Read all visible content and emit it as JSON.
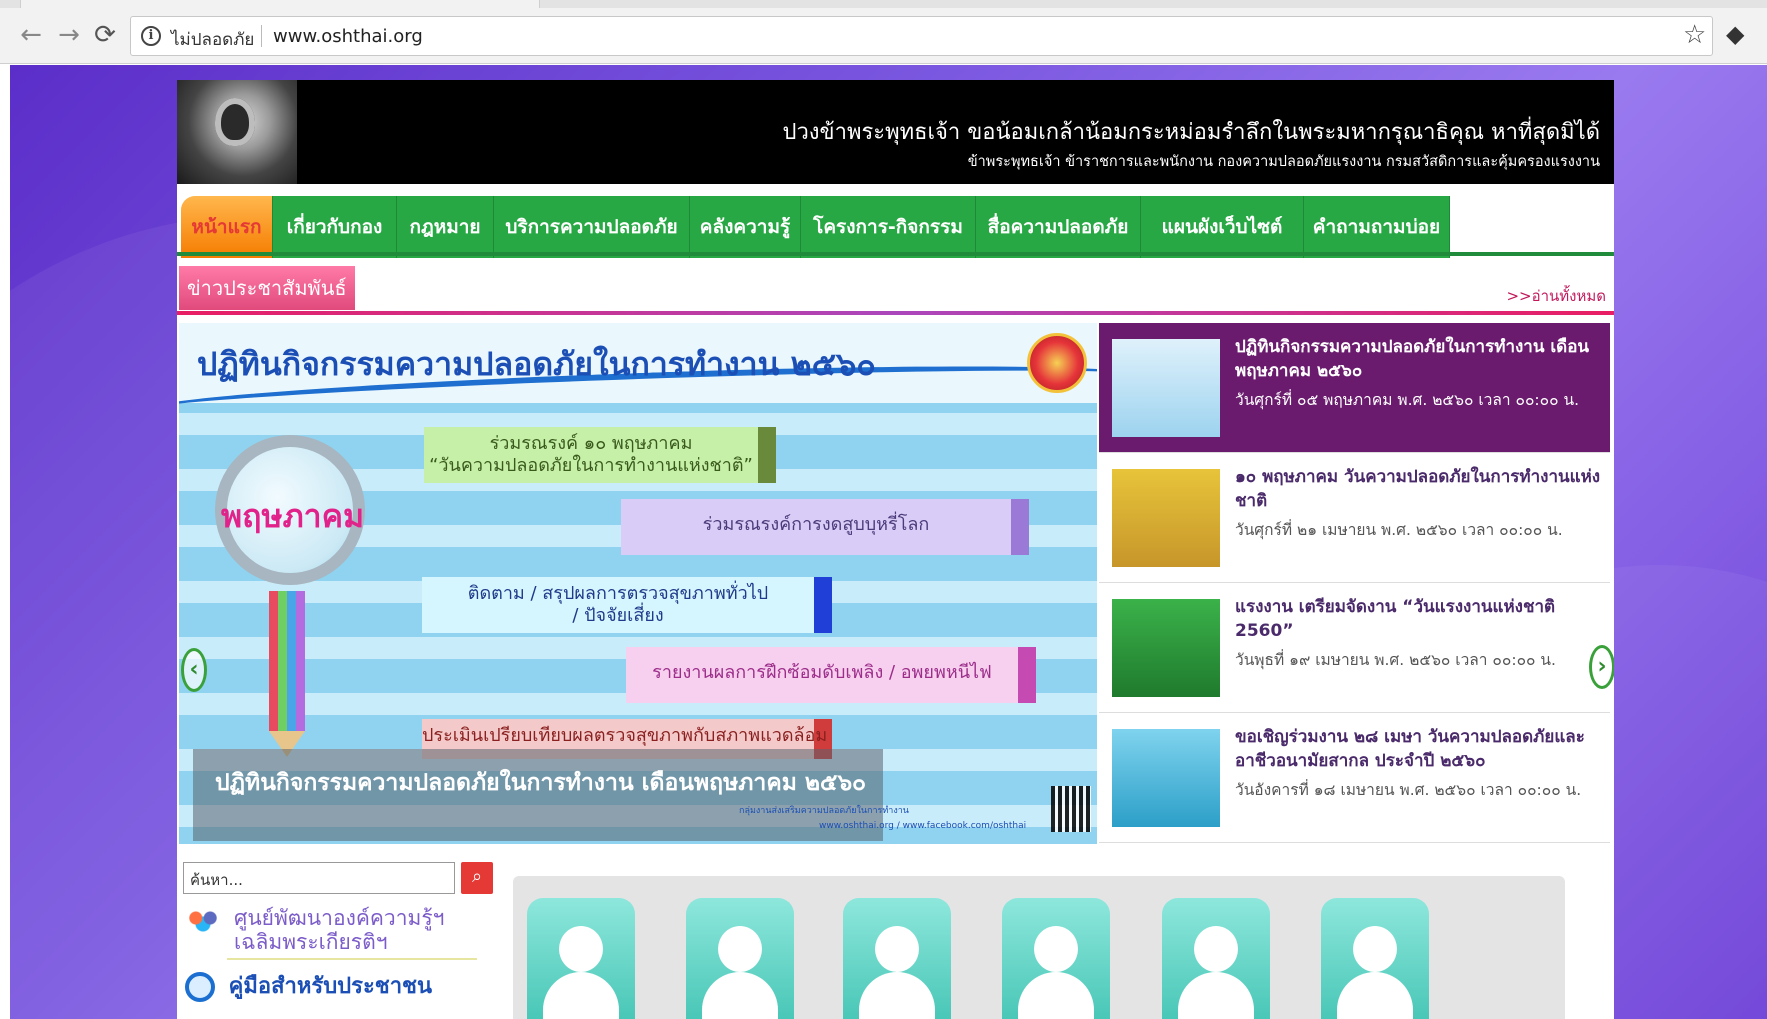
{
  "browser": {
    "security_label": "ไม่ปลอดภัย",
    "url": "www.oshthai.org",
    "back_icon": "arrow-left-icon",
    "forward_icon": "arrow-right-icon",
    "reload_icon": "reload-icon",
    "star_icon": "star-icon"
  },
  "header": {
    "line1": "ปวงข้าพระพุทธเจ้า ขอน้อมเกล้าน้อมกระหม่อมรำลึกในพระมหากรุณาธิคุณ หาที่สุดมิได้",
    "line2": "ข้าพระพุทธเจ้า ข้าราชการและพนักงาน กองความปลอดภัยแรงงาน กรมสวัสดิการและคุ้มครองแรงงาน"
  },
  "nav": {
    "items": [
      {
        "label": "หน้าแรก"
      },
      {
        "label": "เกี่ยวกับกอง"
      },
      {
        "label": "กฎหมาย"
      },
      {
        "label": "บริการความปลอดภัย"
      },
      {
        "label": "คลังความรู้"
      },
      {
        "label": "โครงการ-กิจกรรม"
      },
      {
        "label": "สื่อความปลอดภัย"
      },
      {
        "label": "แผนผังเว็บไซต์"
      },
      {
        "label": "คำถามถามบ่อย"
      }
    ],
    "colors": {
      "green": "#27a844",
      "active": "#f57c00"
    }
  },
  "news_section": {
    "tag": "ข่าวประชาสัมพันธ์",
    "read_all": ">>อ่านทั้งหมด"
  },
  "slider": {
    "title": "ปฏิทินกิจกรรมความปลอดภัยในการทำงาน ๒๕๖๐",
    "magnifier_word": "พฤษภาคม",
    "banner1_line1": "ร่วมรณรงค์ ๑๐ พฤษภาคม",
    "banner1_line2": "“วันความปลอดภัยในการทำงานแห่งชาติ”",
    "banner2": "ร่วมรณรงค์การงดสูบบุหรี่โลก",
    "banner3_line1": "ติดตาม / สรุปผลการตรวจสุขภาพทั่วไป",
    "banner3_line2": "/ ปัจจัยเสี่ยง",
    "banner4": "รายงานผลการฝึกซ้อมดับเพลิง / อพยพหนีไฟ",
    "banner5": "ประเมินเปรียบเทียบผลตรวจสุขภาพกับสภาพแวดล้อม",
    "caption": "ปฏิทินกิจกรรมความปลอดภัยในการทำงาน เดือนพฤษภาคม ๒๕๖๐",
    "footer1": "กลุ่มงานส่งเสริมความปลอดภัยในการทำงาน",
    "footer2": "www.oshthai.org / www.facebook.com/oshthai"
  },
  "news_list": [
    {
      "title": "ปฏิทินกิจกรรมความปลอดภัยในการทำงาน เดือนพฤษภาคม ๒๕๖๐",
      "date": "วันศุกร์ที่ ๐๕ พฤษภาคม พ.ศ. ๒๕๖๐ เวลา ๐๐:๐๐ น."
    },
    {
      "title": "๑๐ พฤษภาคม วันความปลอดภัยในการทำงานแห่งชาติ",
      "date": "วันศุกร์ที่ ๒๑ เมษายน พ.ศ. ๒๕๖๐ เวลา ๐๐:๐๐ น."
    },
    {
      "title": "แรงงาน เตรียมจัดงาน “วันแรงงานแห่งชาติ 2560”",
      "date": "วันพุธที่ ๑๙ เมษายน พ.ศ. ๒๕๖๐ เวลา ๐๐:๐๐ น."
    },
    {
      "title": "ขอเชิญร่วมงาน ๒๘ เมษา วันความปลอดภัยและอาชีวอนามัยสากล ประจำปี ๒๕๖๐",
      "date": "วันอังคารที่ ๑๘ เมษายน พ.ศ. ๒๕๖๐ เวลา ๐๐:๐๐ น."
    }
  ],
  "search": {
    "placeholder": "ค้นหา..."
  },
  "sidebar": {
    "link1_line1": "ศูนย์พัฒนาองค์ความรู้ฯ",
    "link1_line2": "เฉลิมพระเกียรติฯ",
    "link2": "คู่มือสำหรับประชาชน"
  }
}
